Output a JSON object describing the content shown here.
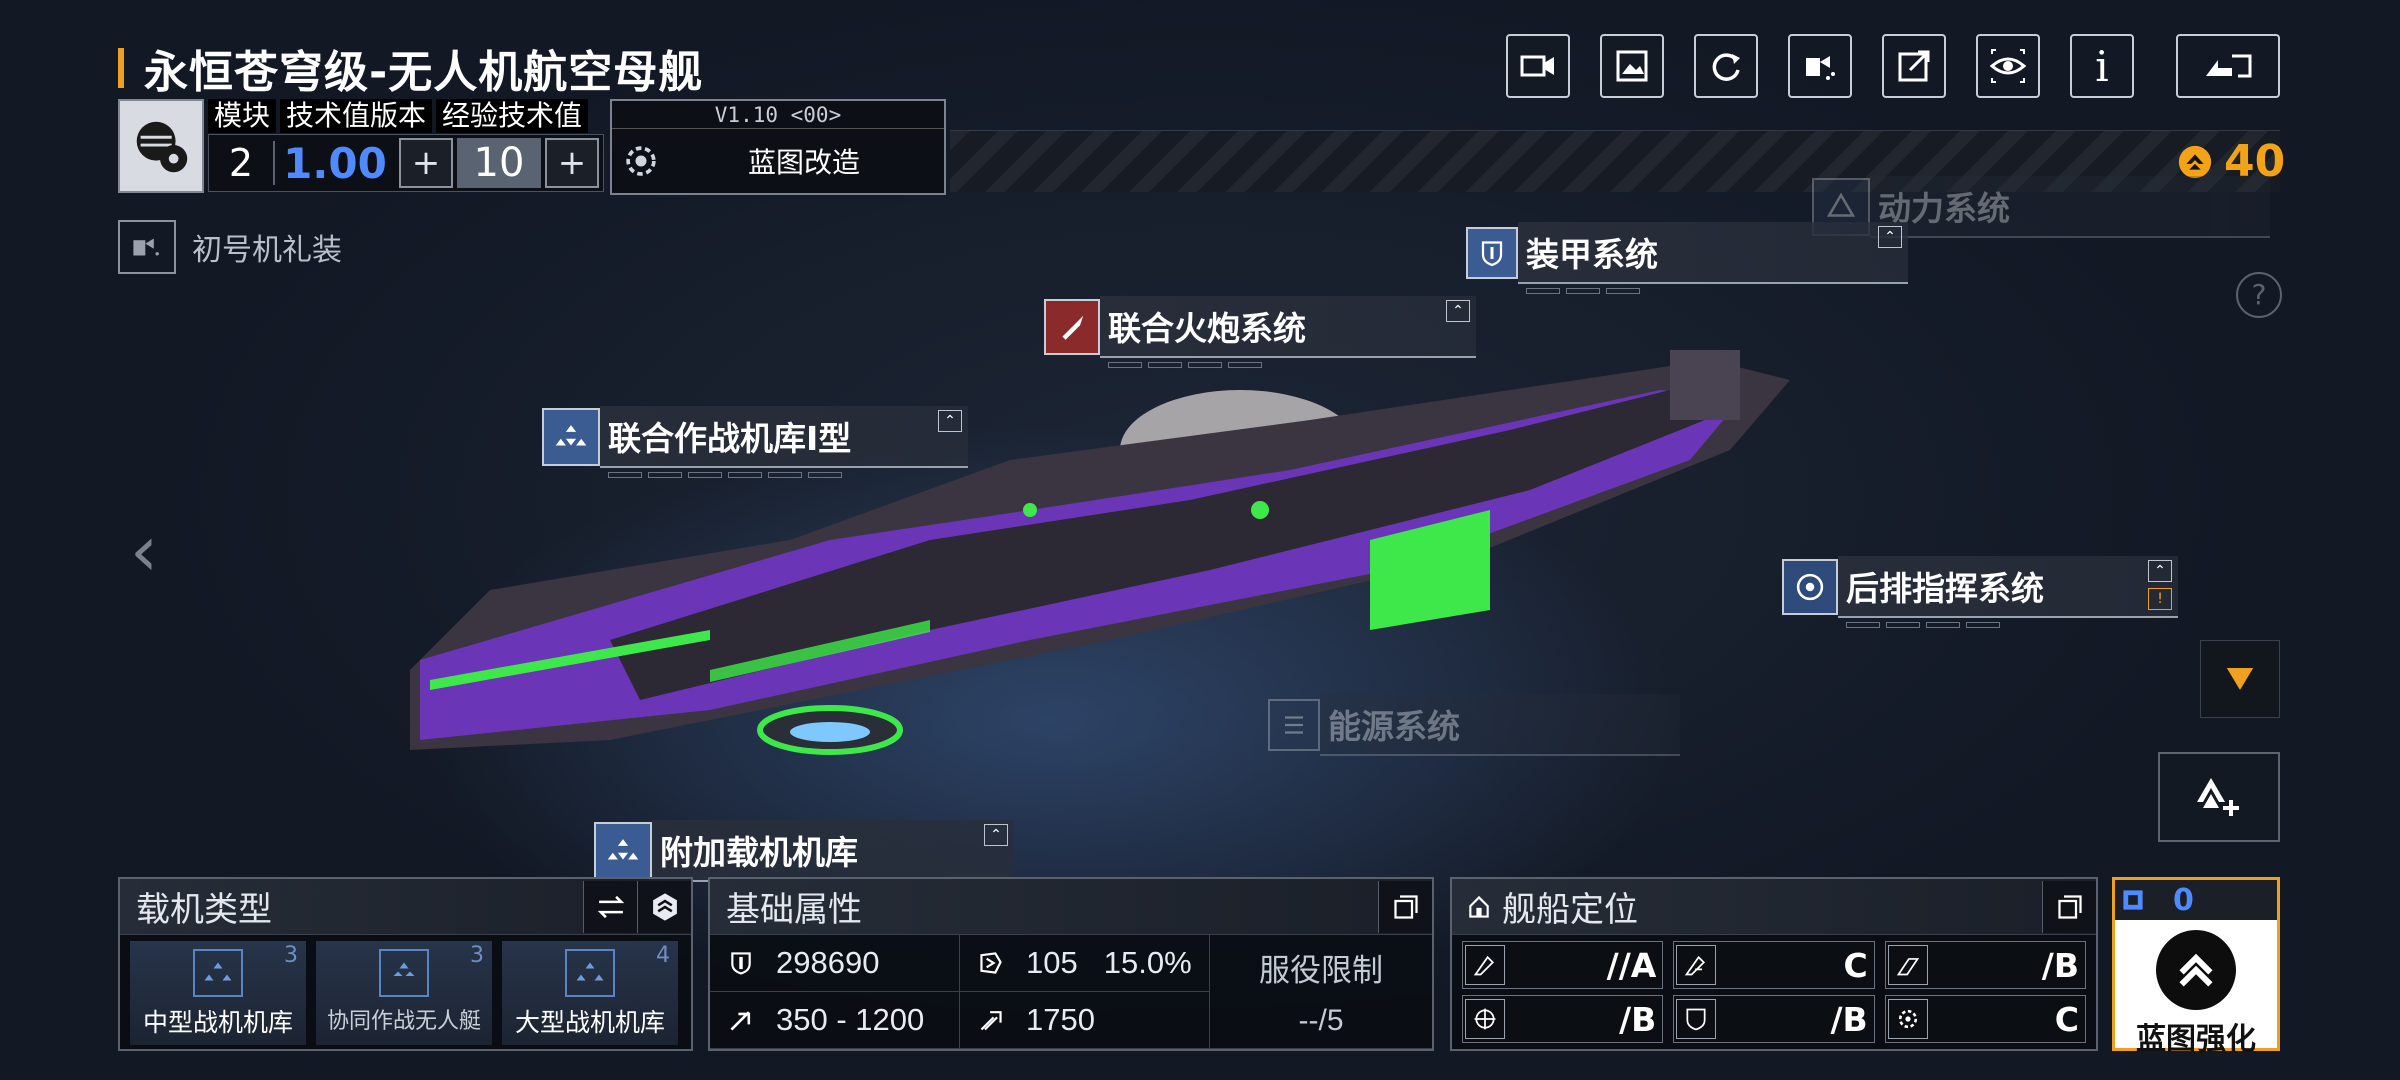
{
  "title": "永恒苍穹级-无人机航空母舰",
  "module": {
    "headers": [
      "模块",
      "技术值版本",
      "经验技术值"
    ],
    "count": "2",
    "tech_version": "1.00",
    "exp_value": "10",
    "plus_glyph": "+"
  },
  "version_box": {
    "version": "V1.10 <00>",
    "blueprint_label": "蓝图改造"
  },
  "currency": {
    "value": "40",
    "color": "#f3a317"
  },
  "outfit_label": "初号机礼装",
  "top_buttons": [
    "camera-icon",
    "photo-icon",
    "refresh-icon",
    "paint-icon",
    "share-icon",
    "eye-icon",
    "info-icon",
    "back-icon"
  ],
  "info_glyph": "i",
  "help_glyph": "?",
  "nav_left_glyph": "‹",
  "callouts": {
    "power": "动力系统",
    "armor": "装甲系统",
    "artillery": "联合火炮系统",
    "hangar": "联合作战机库I型",
    "command": "后排指挥系统",
    "energy": "能源系统",
    "extra_hangar": "附加载机机库"
  },
  "carrier_panel": {
    "title": "载机类型",
    "cards": [
      {
        "count": "3",
        "label": "中型战机机库"
      },
      {
        "count": "3",
        "label": "协同作战无人艇"
      },
      {
        "count": "4",
        "label": "大型战机机库"
      }
    ]
  },
  "attr_panel": {
    "title": "基础属性",
    "hp": "298690",
    "armor_value": "105",
    "armor_pct": "15.0%",
    "range": "350 - 1200",
    "speed": "1750",
    "service_label": "服役限制",
    "service_value": "--/5"
  },
  "position_panel": {
    "title": "舰船定位",
    "grades": [
      "//A",
      "C",
      "/B",
      "/B",
      "/B",
      "C"
    ]
  },
  "enhance": {
    "count": "0",
    "label": "蓝图强化"
  },
  "colors": {
    "accent": "#f0a020",
    "blue": "#4f8bff",
    "ship_purple": "#7a3fd0",
    "ship_green": "#3ee84a"
  }
}
